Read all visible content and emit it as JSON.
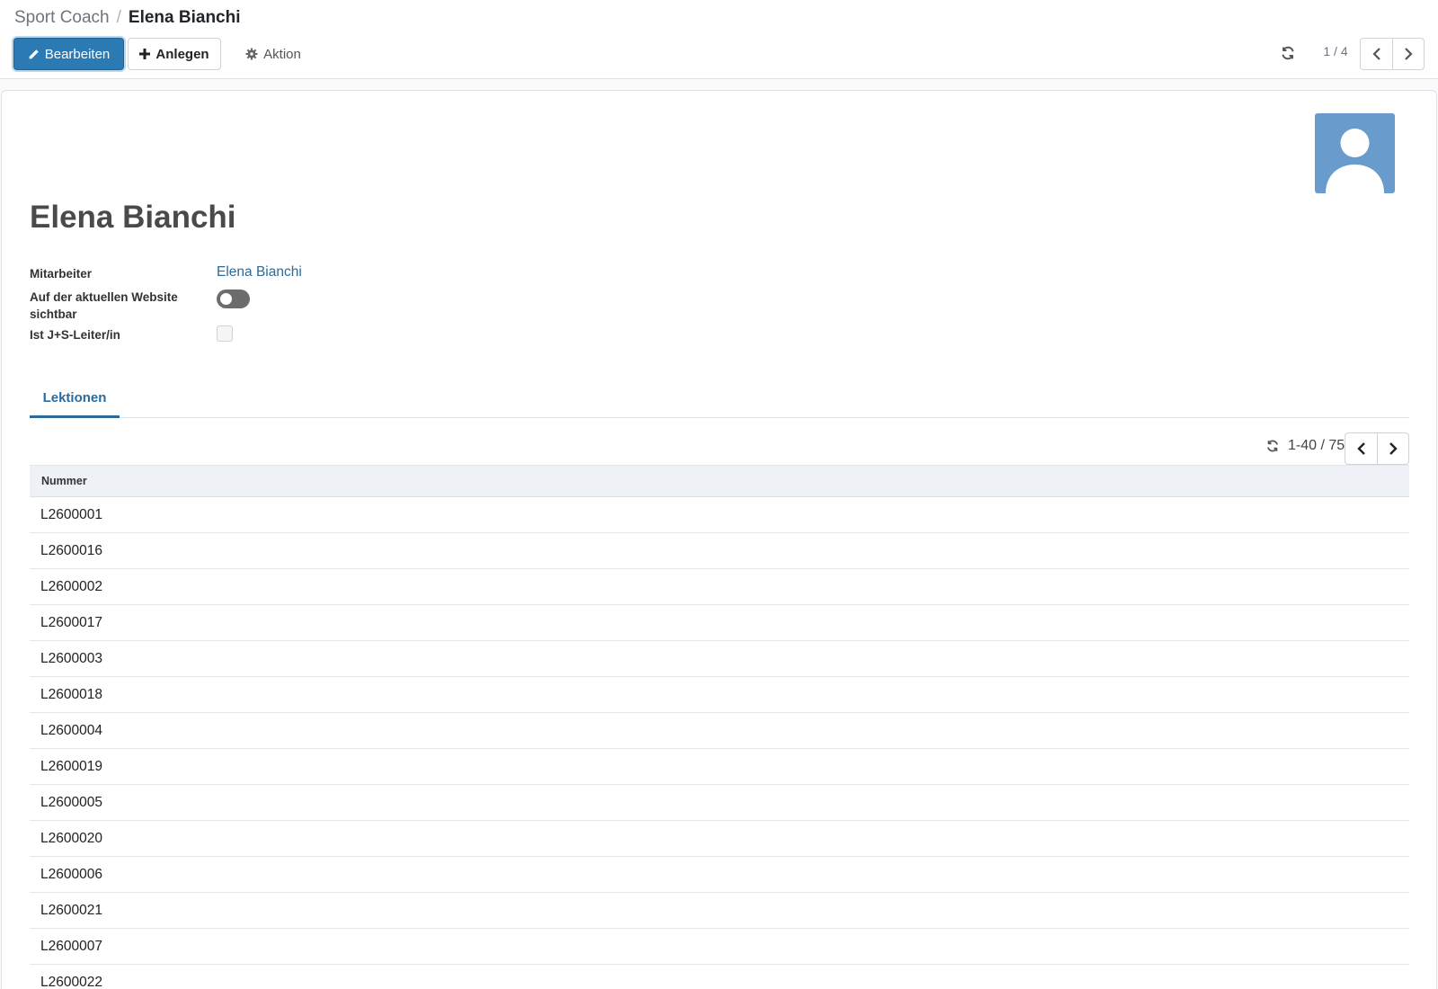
{
  "breadcrumb": {
    "parent": "Sport Coach",
    "separator": "/",
    "current": "Elena Bianchi"
  },
  "toolbar": {
    "edit_label": "Bearbeiten",
    "create_label": "Anlegen",
    "action_label": "Aktion"
  },
  "record_pager": {
    "value": "1 / 4"
  },
  "record": {
    "name": "Elena Bianchi",
    "fields": {
      "employee_label": "Mitarbeiter",
      "employee_value": "Elena Bianchi",
      "website_label_line1": "Auf der aktuellen Website",
      "website_label_line2": "sichtbar",
      "website_published": false,
      "js_leader_label": "Ist J+S-Leiter/in",
      "js_leader": false
    }
  },
  "tabs": [
    {
      "label": "Lektionen",
      "active": true
    }
  ],
  "lessons": {
    "pager": "1-40 / 75",
    "column_header": "Nummer",
    "rows": [
      "L2600001",
      "L2600016",
      "L2600002",
      "L2600017",
      "L2600003",
      "L2600018",
      "L2600004",
      "L2600019",
      "L2600005",
      "L2600020",
      "L2600006",
      "L2600021",
      "L2600007",
      "L2600022"
    ]
  },
  "colors": {
    "primary": "#2b7ab3",
    "link": "#2b6a9a",
    "avatar_bg": "#6a9bcd",
    "header_bg": "#eef2f6"
  },
  "icons": {
    "edit": "pencil-icon",
    "create": "plus-icon",
    "action": "gear-icon",
    "refresh": "refresh-icon",
    "prev": "chevron-left-icon",
    "next": "chevron-right-icon",
    "avatar": "user-silhouette-icon"
  }
}
